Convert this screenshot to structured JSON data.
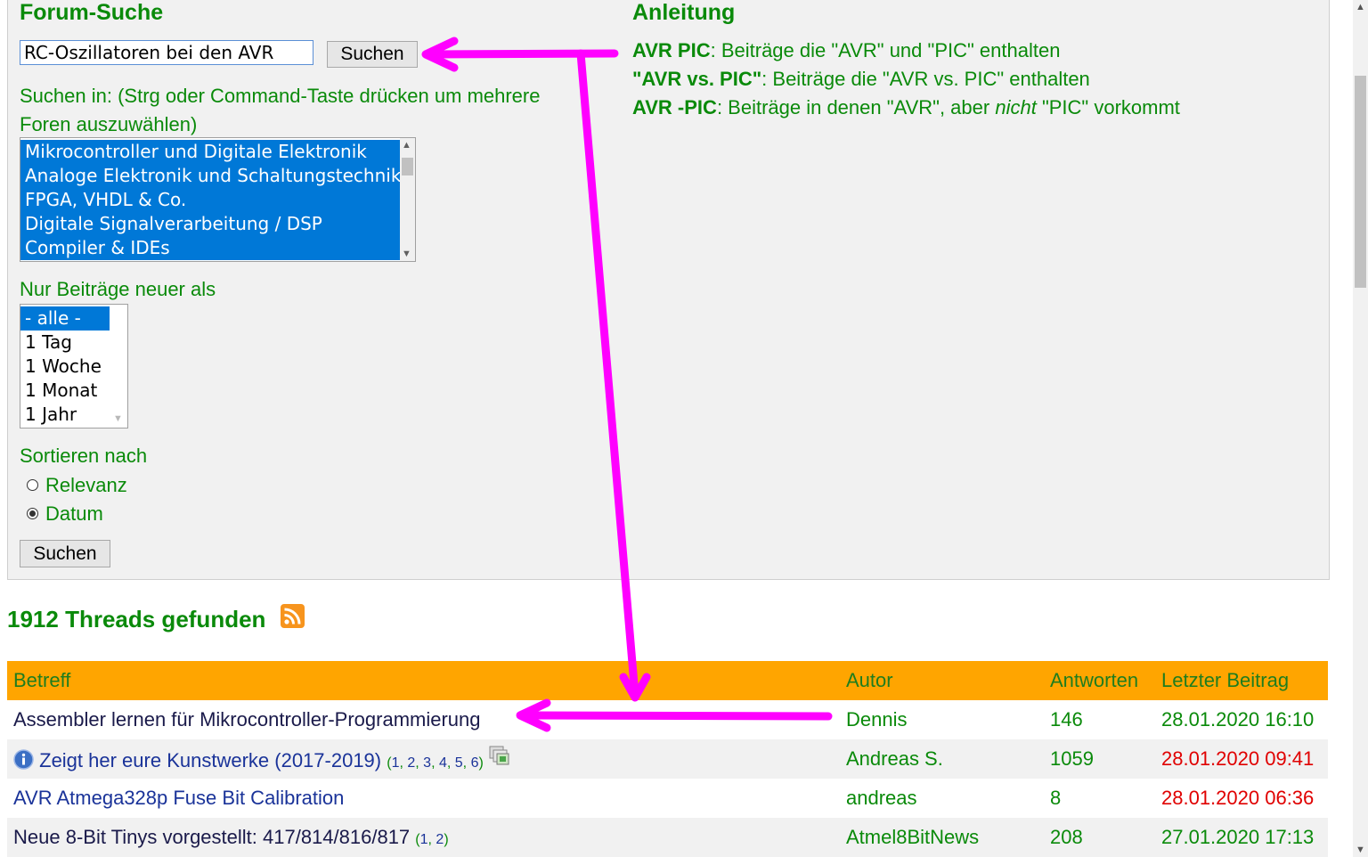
{
  "search": {
    "title": "Forum-Suche",
    "query_value": "RC-Oszillatoren bei den AVR",
    "search_button": "Suchen",
    "search_in_label": "Suchen in: (Strg oder Command-Taste drücken um mehrere Foren auszuwählen)",
    "forums": [
      {
        "label": "Mikrocontroller und Digitale Elektronik",
        "selected": true
      },
      {
        "label": "Analoge Elektronik und Schaltungstechnik",
        "selected": true
      },
      {
        "label": "FPGA, VHDL & Co.",
        "selected": true
      },
      {
        "label": "Digitale Signalverarbeitung / DSP",
        "selected": true
      },
      {
        "label": "Compiler & IDEs",
        "selected": true
      }
    ],
    "newer_than_label": "Nur Beiträge neuer als",
    "newer_than_options": [
      {
        "label": "- alle -",
        "selected": true
      },
      {
        "label": "1 Tag",
        "selected": false
      },
      {
        "label": "1 Woche",
        "selected": false
      },
      {
        "label": "1 Monat",
        "selected": false
      },
      {
        "label": "1 Jahr",
        "selected": false
      }
    ],
    "sort_label": "Sortieren nach",
    "sort_relevance": "Relevanz",
    "sort_date": "Datum",
    "sort_selected": "Datum",
    "submit_button": "Suchen"
  },
  "help": {
    "title": "Anleitung",
    "line1_term": "AVR PIC",
    "line1_text": ": Beiträge die \"AVR\" und \"PIC\" enthalten",
    "line2_term": "\"AVR vs. PIC\"",
    "line2_text": ": Beiträge die \"AVR vs. PIC\" enthalten",
    "line3_term": "AVR -PIC",
    "line3_text_a": ": Beiträge in denen \"AVR\", aber ",
    "line3_em": "nicht",
    "line3_text_b": " \"PIC\" vorkommt"
  },
  "results": {
    "title": "1912 Threads gefunden",
    "columns": {
      "subject": "Betreff",
      "author": "Autor",
      "replies": "Antworten",
      "last_post": "Letzter Beitrag"
    },
    "rows": [
      {
        "subject": "Assembler lernen für Mikrocontroller-Programmierung",
        "pages": [],
        "author": "Dennis",
        "replies": "146",
        "last_post": "28.01.2020 16:10",
        "date_red": false
      },
      {
        "subject": "Zeigt her eure Kunstwerke (2017-2019)",
        "pages": [
          "1",
          "2",
          "3",
          "4",
          "5",
          "6"
        ],
        "author": "Andreas S.",
        "replies": "1059",
        "last_post": "28.01.2020 09:41",
        "date_red": true
      },
      {
        "subject": "AVR Atmega328p Fuse Bit Calibration",
        "pages": [],
        "author": "andreas",
        "replies": "8",
        "last_post": "28.01.2020 06:36",
        "date_red": true
      },
      {
        "subject": "Neue 8-Bit Tinys vorgestellt: 417/814/816/817",
        "pages": [
          "1",
          "2"
        ],
        "author": "Atmel8BitNews",
        "replies": "208",
        "last_post": "27.01.2020 17:13",
        "date_red": false
      }
    ]
  },
  "colors": {
    "accent_green": "#0a8a0a",
    "header_orange": "#ffa500",
    "annotation_magenta": "#ff00ff",
    "link_blue": "#1a3399",
    "recent_red": "#e00000"
  }
}
